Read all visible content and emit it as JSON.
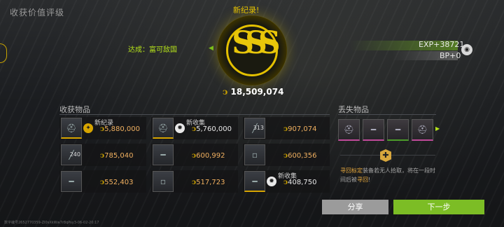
{
  "page": {
    "title": "收获价值评级"
  },
  "header": {
    "new_record": "新纪录!",
    "achievement": "达成：富可敌国",
    "exp": "EXP+38721",
    "bp": "BP+0",
    "rating": "SSS",
    "total_value": "18,509,074"
  },
  "harvest": {
    "label": "收获物品",
    "items": [
      {
        "tag": "新纪录",
        "value": "5,880,000",
        "icon": "helmet-icon",
        "badge": "record-icon",
        "count": ""
      },
      {
        "tag": "新收集",
        "value": "5,760,000",
        "icon": "helmet-icon",
        "badge": "collect-icon",
        "count": ""
      },
      {
        "tag": "",
        "value": "907,074",
        "icon": "ammo-icon",
        "badge": "",
        "count": "313"
      },
      {
        "tag": "",
        "value": "785,040",
        "icon": "ammo-icon",
        "badge": "",
        "count": "240"
      },
      {
        "tag": "",
        "value": "600,992",
        "icon": "rifle-icon",
        "badge": "",
        "count": ""
      },
      {
        "tag": "",
        "value": "600,356",
        "icon": "item-icon",
        "badge": "",
        "count": ""
      },
      {
        "tag": "",
        "value": "552,403",
        "icon": "rifle-icon",
        "badge": "",
        "count": ""
      },
      {
        "tag": "",
        "value": "517,723",
        "icon": "item-icon",
        "badge": "",
        "count": ""
      },
      {
        "tag": "新收集",
        "value": "408,750",
        "icon": "rifle-icon",
        "badge": "collect-icon",
        "count": ""
      }
    ]
  },
  "lost": {
    "label": "丢失物品",
    "items": [
      {
        "icon": "helmet-icon",
        "rarity_color": "#c04a9a"
      },
      {
        "icon": "rifle-icon",
        "rarity_color": "#c04a9a"
      },
      {
        "icon": "rifle-icon",
        "rarity_color": "#4c9c2a"
      },
      {
        "icon": "helmet-icon",
        "rarity_color": "#c04a9a"
      }
    ],
    "find_highlight": "寻回标定",
    "find_body": "装备若无人拾取，将在一段时间后被",
    "find_tail": "寻回",
    "find_end": "!"
  },
  "buttons": {
    "share": "分享",
    "next": "下一步"
  },
  "footer": "数字编号2652770359-ZI0sXkWw7r8qPsy3-06-02-20:17",
  "colors": {
    "accent_gold": "#e3c000",
    "accent_green": "#7cbd25",
    "value_orange": "#f0b060"
  }
}
